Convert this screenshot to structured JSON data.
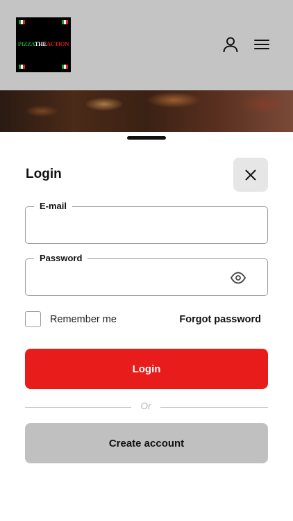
{
  "header": {
    "logo": {
      "word_1": "PIZZA",
      "word_2": "THE",
      "word_3": "ACTION",
      "colors": {
        "green": "#1a9c3a",
        "white": "#ffffff",
        "red": "#d82020"
      }
    },
    "account_icon": "person-icon",
    "menu_icon": "hamburger-menu-icon"
  },
  "login_sheet": {
    "title": "Login",
    "close_icon": "close-icon",
    "email_field": {
      "label": "E-mail",
      "value": "",
      "placeholder": ""
    },
    "password_field": {
      "label": "Password",
      "value": "",
      "placeholder": "",
      "toggle_icon": "eye-icon"
    },
    "remember_me": {
      "label": "Remember me",
      "checked": false
    },
    "forgot_password_label": "Forgot password",
    "login_button_label": "Login",
    "divider_text": "Or",
    "create_account_label": "Create account"
  },
  "colors": {
    "primary": "#e91c1c",
    "secondary_button": "#c0c0c0",
    "header_bg": "#c4c4c4"
  }
}
